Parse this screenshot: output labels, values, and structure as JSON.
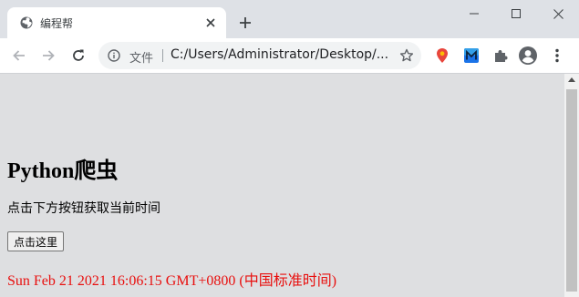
{
  "browser": {
    "tab": {
      "title": "编程帮"
    },
    "security_label": "文件",
    "url": "C:/Users/Administrator/Desktop/..."
  },
  "page": {
    "heading": "Python爬虫",
    "instruction": "点击下方按钮获取当前时间",
    "button_label": "点击这里",
    "time_output": "Sun Feb 21 2021 16:06:15 GMT+0800 (中国标准时间)"
  },
  "colors": {
    "page_background": "#dedfe1",
    "time_text": "#e8100f",
    "tabstrip": "#dee1e6"
  }
}
